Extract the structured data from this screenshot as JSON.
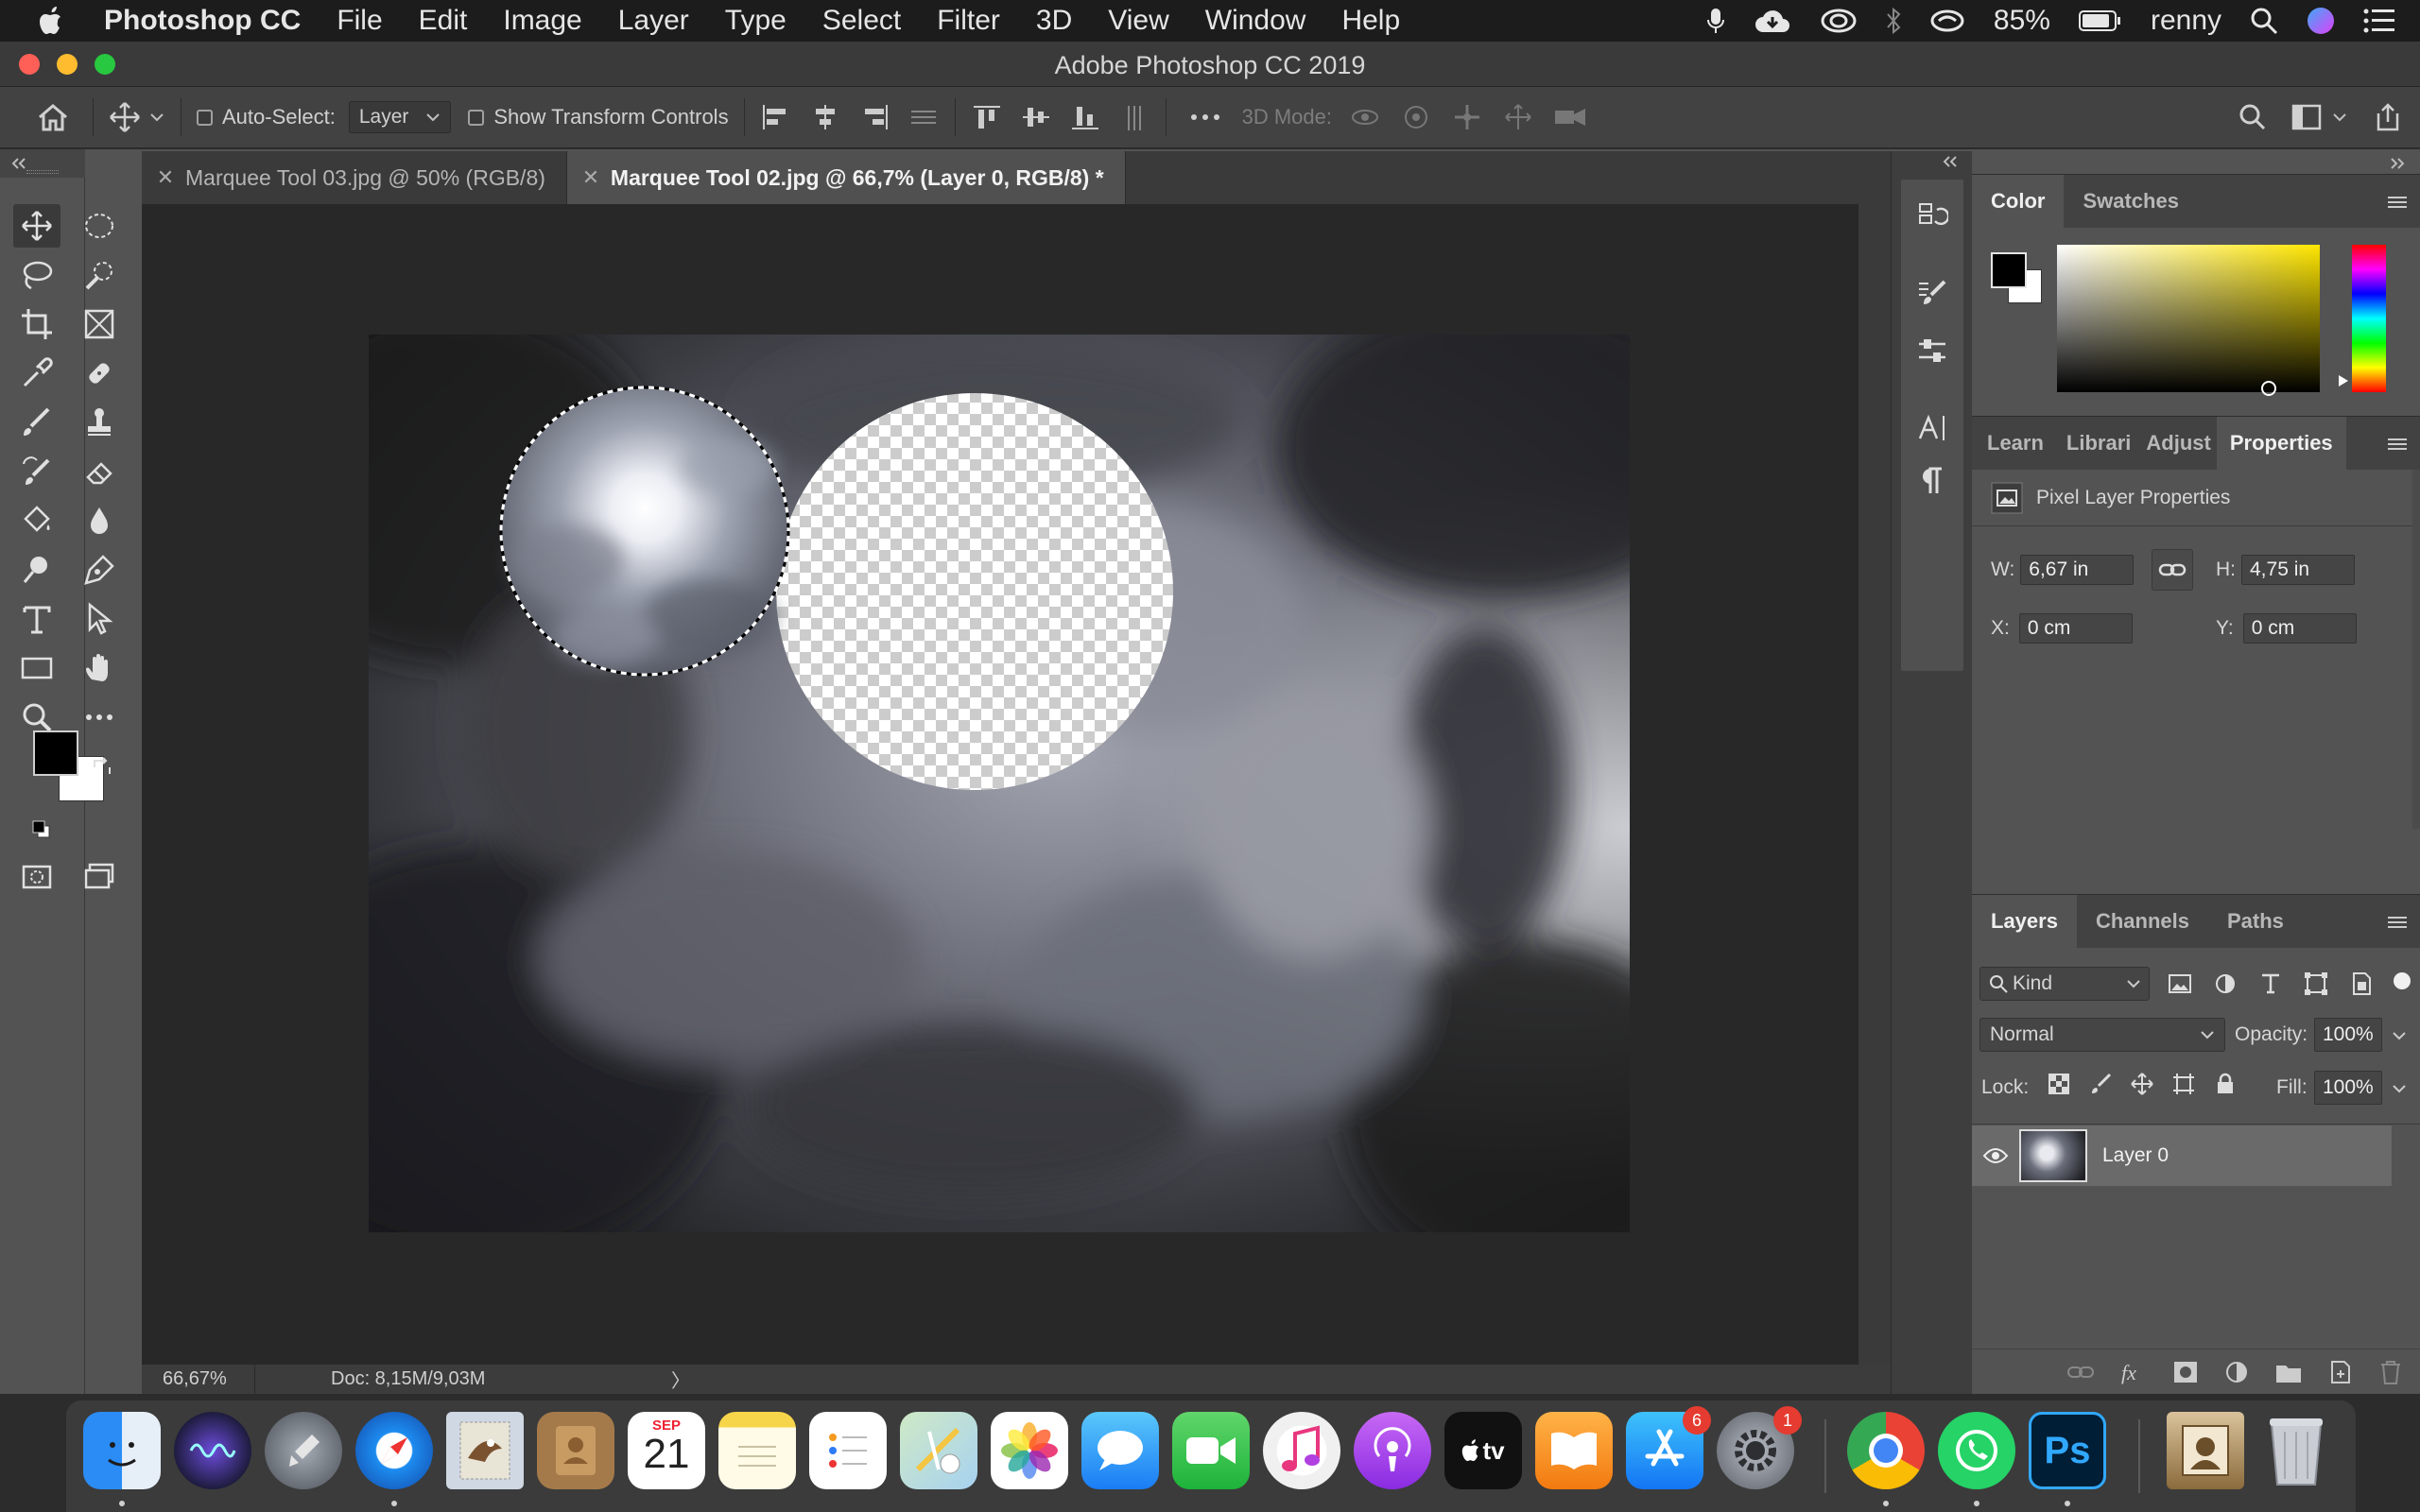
{
  "menubar": {
    "app_name": "Photoshop CC",
    "items": [
      "File",
      "Edit",
      "Image",
      "Layer",
      "Type",
      "Select",
      "Filter",
      "3D",
      "View",
      "Window",
      "Help"
    ],
    "battery": "85%",
    "user": "renny"
  },
  "window": {
    "title": "Adobe Photoshop CC 2019"
  },
  "options_bar": {
    "auto_select_label": "Auto-Select:",
    "auto_select_value": "Layer",
    "show_transform_label": "Show Transform Controls",
    "mode_3d_label": "3D Mode:"
  },
  "tabs": [
    {
      "label": "Marquee Tool 03.jpg @ 50% (RGB/8)",
      "active": false
    },
    {
      "label": "Marquee Tool 02.jpg @ 66,7% (Layer 0, RGB/8) *",
      "active": true
    }
  ],
  "status": {
    "zoom": "66,67%",
    "doc": "Doc: 8,15M/9,03M",
    "arrow": "〉"
  },
  "color_panel": {
    "tabs": [
      "Color",
      "Swatches"
    ],
    "foreground": "#000000",
    "background": "#ffffff"
  },
  "properties_panel": {
    "tabs": [
      "Learn",
      "Librari",
      "Adjust",
      "Properties"
    ],
    "heading": "Pixel Layer Properties",
    "w_label": "W:",
    "w_value": "6,67 in",
    "h_label": "H:",
    "h_value": "4,75 in",
    "x_label": "X:",
    "x_value": "0 cm",
    "y_label": "Y:",
    "y_value": "0 cm"
  },
  "layers_panel": {
    "tabs": [
      "Layers",
      "Channels",
      "Paths"
    ],
    "filter": "Kind",
    "blend_mode": "Normal",
    "opacity_label": "Opacity:",
    "opacity": "100%",
    "lock_label": "Lock:",
    "fill_label": "Fill:",
    "fill": "100%",
    "layers": [
      {
        "name": "Layer 0",
        "visible": true
      }
    ]
  },
  "dock": {
    "calendar_month": "SEP",
    "calendar_day": "21",
    "appstore_badge": "6",
    "prefs_badge": "1",
    "ps_label": "Ps",
    "tv_label": "tv"
  }
}
